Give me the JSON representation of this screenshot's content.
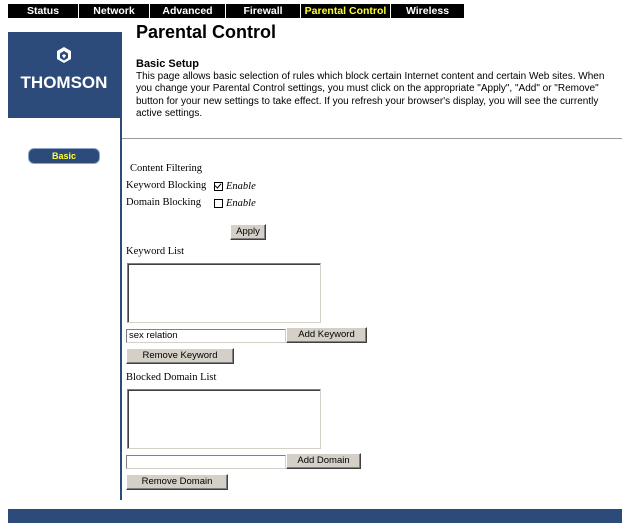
{
  "nav": {
    "tabs": [
      {
        "label": "Status"
      },
      {
        "label": "Network"
      },
      {
        "label": "Advanced"
      },
      {
        "label": "Firewall"
      },
      {
        "label": "Parental Control"
      },
      {
        "label": "Wireless"
      }
    ],
    "active_tab": "Parental Control",
    "active_color": "#ffff33"
  },
  "brand": {
    "logo_text": "THOMSON",
    "color": "#2c4a7a"
  },
  "sidebar": {
    "items": [
      {
        "label": "Basic"
      }
    ]
  },
  "page": {
    "title": "Parental Control",
    "section_title": "Basic Setup",
    "intro_lines": [
      "This page allows basic selection of rules which block certain Internet content and certain Web sites. When",
      "you change your Parental Control settings, you must click on the appropriate \"Apply\", \"Add\" or \"Remove\"",
      "button for your new settings to take effect. If you refresh your browser's display, you will see the currently",
      "active settings."
    ]
  },
  "filtering": {
    "heading": "Content Filtering",
    "keyword_blocking_label": "Keyword Blocking",
    "keyword_blocking_enable": "Enable",
    "keyword_blocking_checked": true,
    "domain_blocking_label": "Domain Blocking",
    "domain_blocking_enable": "Enable",
    "domain_blocking_checked": false,
    "apply_label": "Apply"
  },
  "keywords": {
    "list_label": "Keyword List",
    "input_value": "sex relation",
    "add_label": "Add Keyword",
    "remove_label": "Remove Keyword"
  },
  "domains": {
    "list_label": "Blocked Domain List",
    "input_value": "",
    "add_label": "Add Domain",
    "remove_label": "Remove Domain"
  }
}
